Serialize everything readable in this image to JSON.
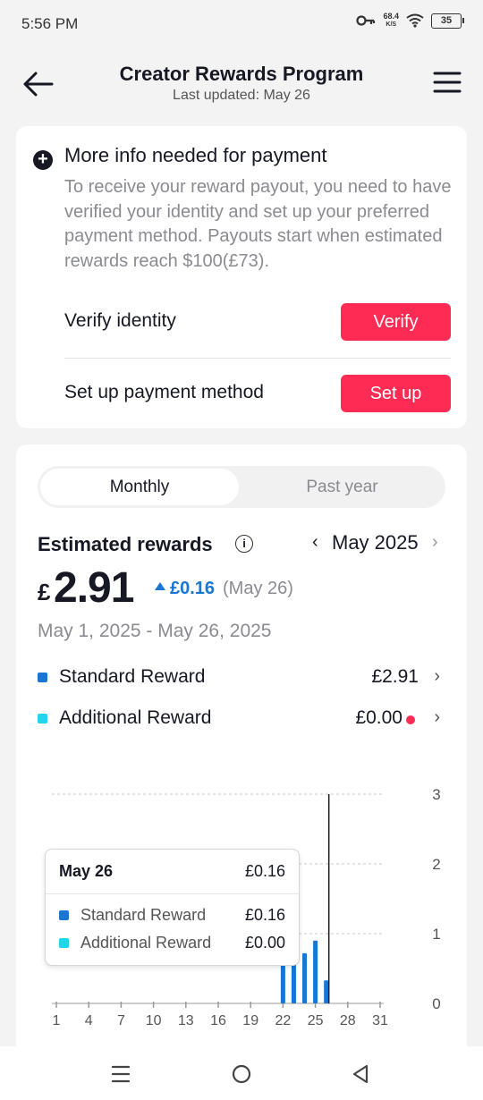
{
  "status_bar": {
    "time": "5:56 PM",
    "net_speed_value": "68.4",
    "net_speed_unit": "K/S",
    "battery": "35",
    "icons": [
      "key-icon",
      "wifi-icon",
      "battery-icon"
    ]
  },
  "header": {
    "title": "Creator Rewards Program",
    "subtitle": "Last updated: May 26",
    "back_icon": "arrow-left-icon",
    "menu_icon": "hamburger-menu-icon"
  },
  "payment_card": {
    "icon": "plus-circle-icon",
    "title": "More info needed for payment",
    "description": "To receive your reward payout, you need to have verified your identity and set up your preferred payment method. Payouts start when estimated rewards reach $100(£73).",
    "rows": [
      {
        "label": "Verify identity",
        "button": "Verify"
      },
      {
        "label": "Set up payment method",
        "button": "Set up"
      }
    ]
  },
  "rewards_card": {
    "tabs": [
      {
        "label": "Monthly",
        "active": true
      },
      {
        "label": "Past year",
        "active": false
      }
    ],
    "title": "Estimated rewards",
    "month": "May 2025",
    "currency": "£",
    "amount": "2.91",
    "delta": "£0.16",
    "delta_date": "(May 26)",
    "range": "May 1, 2025 - May 26, 2025",
    "legend": [
      {
        "label": "Standard Reward",
        "value": "£2.91",
        "color": "#1976d2"
      },
      {
        "label": "Additional Reward",
        "value": "£0.00",
        "color": "#20d5ec"
      }
    ],
    "tooltip": {
      "title": "May 26",
      "total": "£0.16",
      "rows": [
        {
          "label": "Standard Reward",
          "value": "£0.16"
        },
        {
          "label": "Additional Reward",
          "value": "£0.00"
        }
      ]
    }
  },
  "chart_data": {
    "type": "bar",
    "x": [
      22,
      23,
      24,
      25,
      26
    ],
    "series": [
      {
        "values": [
          0.75,
          0.72,
          0.72,
          0.9,
          0.33
        ]
      },
      {
        "values": [
          0,
          0,
          0,
          0,
          0
        ]
      }
    ],
    "xticks": [
      "1",
      "4",
      "7",
      "10",
      "13",
      "16",
      "19",
      "22",
      "25",
      "28",
      "31"
    ],
    "yticks": [
      "0",
      "1",
      "2",
      "3"
    ],
    "xlim": [
      1,
      31
    ],
    "ylim": [
      0,
      3
    ],
    "grid": true,
    "highlight_day": 26,
    "colors": {
      "standard": "#1976d2",
      "additional": "#20d5ec",
      "accent": "#fe2c55"
    }
  },
  "navbar": {
    "icons": [
      "recent-apps-icon",
      "home-icon",
      "back-triangle-icon"
    ]
  }
}
